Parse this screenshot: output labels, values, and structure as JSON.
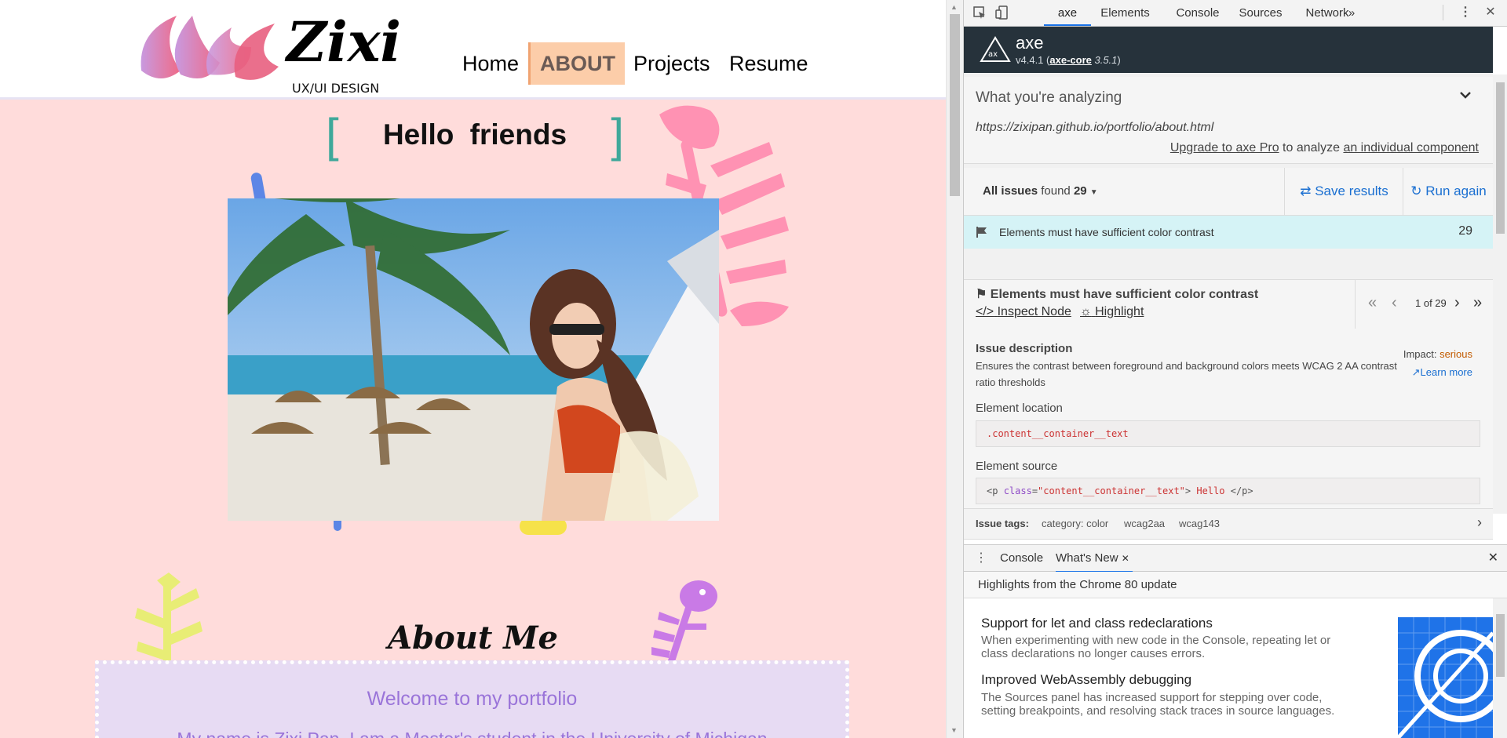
{
  "site": {
    "logo_text": "Zixi",
    "logo_subtitle": "UX/UI DESIGN",
    "nav": [
      "Home",
      "ABOUT",
      "Projects",
      "Resume"
    ],
    "hello_left_bracket": "[",
    "hello_right_bracket": "]",
    "hello": "Hello friends",
    "about_title": "About Me",
    "welcome": "Welcome to my portfolio",
    "intro": "My name is Zixi Pan. I am a Master's student in the University of Michigan"
  },
  "devtools": {
    "tabs": [
      "axe",
      "Elements",
      "Console",
      "Sources",
      "Network"
    ],
    "more_tabs": "»",
    "axe": {
      "name": "axe",
      "version": "v4.4.1",
      "core_label": "axe-core",
      "core_version": "3.5.1",
      "analyzing_title": "What you're analyzing",
      "url": "https://zixipan.github.io/portfolio/about.html",
      "upgrade_link": "Upgrade to axe Pro",
      "upgrade_middle": "to analyze",
      "upgrade_component": "an individual component",
      "issues_label": "All issues",
      "issues_found": "found",
      "issues_count": "29",
      "save_results": "Save results",
      "run_again": "Run again",
      "issue_title": "Elements must have sufficient color contrast",
      "issue_count": "29",
      "inspect_node": "Inspect Node",
      "highlight": "Highlight",
      "pager": "1 of 29",
      "issue_description_label": "Issue description",
      "issue_description": "Ensures the contrast between foreground and background colors meets WCAG 2 AA contrast ratio thresholds",
      "impact_label": "Impact:",
      "impact_value": "serious",
      "learn_more": "Learn more",
      "element_location_label": "Element location",
      "element_location": ".content__container__text",
      "element_source_label": "Element source",
      "source_tag_open": "<p",
      "source_attr": "class",
      "source_eq": "=",
      "source_value": "\"content__container__text\"",
      "source_gt": ">",
      "source_text": "Hello",
      "source_tag_close": "</p>",
      "issue_tags_label": "Issue tags:",
      "tags": [
        "category: color",
        "wcag2aa",
        "wcag143"
      ]
    },
    "drawer": {
      "tabs": [
        "Console",
        "What's New"
      ],
      "whats_new_header": "Highlights from the Chrome 80 update",
      "items": [
        {
          "title": "Support for let and class redeclarations",
          "desc": "When experimenting with new code in the Console, repeating let or class declarations no longer causes errors."
        },
        {
          "title": "Improved WebAssembly debugging",
          "desc": "The Sources panel has increased support for stepping over code, setting breakpoints, and resolving stack traces in source languages."
        }
      ]
    }
  },
  "colors": {
    "page_bg": "#ffdcdb",
    "nav_active_bg": "#fccda9",
    "bracket": "#3fa89a",
    "about_box_bg": "#e7dbf3",
    "about_text": "#9a74d9",
    "axe_header_bg": "#26323b",
    "link_blue": "#1a6fd1",
    "issue_row_bg": "#d5f3f6",
    "impact_serious": "#c25b00"
  }
}
